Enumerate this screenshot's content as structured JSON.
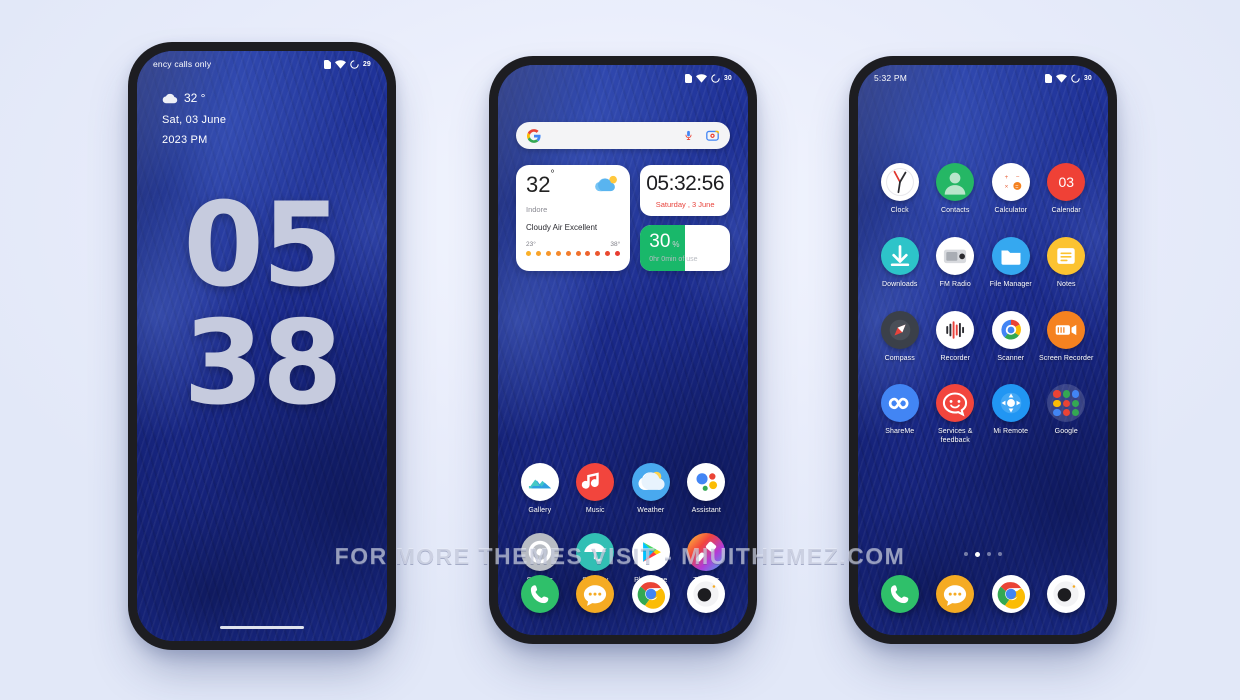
{
  "watermark": "FOR MORE THEMES VISIT - MIUITHEMEZ.COM",
  "colors": {
    "wallpaper_blue": "#1b2b8e",
    "page_background": "#eaeefb",
    "phone_frame": "#1d1d21",
    "accent_red": "#e8433c",
    "battery_green": "#19b86a"
  },
  "phone1": {
    "status": {
      "carrier": "ency calls only",
      "battery": "29"
    },
    "lock": {
      "temperature": "32 °",
      "weather_icon": "cloud-icon",
      "date": "Sat, 03 June",
      "ampm": "2023 PM",
      "clock_hours": "05",
      "clock_minutes": "38"
    }
  },
  "phone2": {
    "status": {
      "time": "",
      "battery": "30"
    },
    "search": {
      "logo": "google-g-icon",
      "mic": "mic-icon",
      "lens": "lens-icon",
      "placeholder": ""
    },
    "weather_widget": {
      "temperature": "32",
      "degree": "°",
      "icon": "cloud-sun-icon",
      "city": "Indore",
      "condition": "Cloudy Air Excellent",
      "low": "23°",
      "high": "38°",
      "dot_count": 10
    },
    "clock_widget": {
      "time": "05:32:56",
      "date": "Saturday , 3 June"
    },
    "battery_widget": {
      "percent": "30",
      "unit": "%",
      "usage": "0hr 0min of use",
      "fill_pct": 50
    },
    "apps": [
      {
        "label": "Gallery",
        "icon": "gallery-icon"
      },
      {
        "label": "Music",
        "icon": "music-icon"
      },
      {
        "label": "Weather",
        "icon": "weather-icon"
      },
      {
        "label": "Assistant",
        "icon": "assistant-icon"
      },
      {
        "label": "Settings",
        "icon": "settings-icon"
      },
      {
        "label": "Security",
        "icon": "security-icon"
      },
      {
        "label": "Play Store",
        "icon": "play-store-icon"
      },
      {
        "label": "Themes",
        "icon": "themes-icon"
      }
    ],
    "dock": [
      {
        "label": "Phone",
        "icon": "phone-icon"
      },
      {
        "label": "Messages",
        "icon": "messages-icon"
      },
      {
        "label": "Chrome",
        "icon": "chrome-icon"
      },
      {
        "label": "Camera",
        "icon": "camera-icon"
      }
    ]
  },
  "phone3": {
    "status": {
      "time": "5:32 PM",
      "battery": "30"
    },
    "apps": [
      {
        "label": "Clock",
        "icon": "clock-icon"
      },
      {
        "label": "Contacts",
        "icon": "contacts-icon"
      },
      {
        "label": "Calculator",
        "icon": "calculator-icon"
      },
      {
        "label": "Calendar",
        "icon": "calendar-icon",
        "day": "03"
      },
      {
        "label": "Downloads",
        "icon": "download-icon"
      },
      {
        "label": "FM Radio",
        "icon": "fm-radio-icon"
      },
      {
        "label": "File Manager",
        "icon": "folder-icon"
      },
      {
        "label": "Notes",
        "icon": "notes-icon"
      },
      {
        "label": "Compass",
        "icon": "compass-icon"
      },
      {
        "label": "Recorder",
        "icon": "recorder-icon"
      },
      {
        "label": "Scanner",
        "icon": "scanner-icon"
      },
      {
        "label": "Screen Recorder",
        "icon": "screen-recorder-icon"
      },
      {
        "label": "ShareMe",
        "icon": "shareme-icon"
      },
      {
        "label": "Services & feedback",
        "icon": "services-feedback-icon"
      },
      {
        "label": "Mi Remote",
        "icon": "mi-remote-icon"
      },
      {
        "label": "Google",
        "icon": "google-folder-icon"
      }
    ],
    "page_dots": {
      "count": 4,
      "active_index": 1
    },
    "dock": [
      {
        "label": "Phone",
        "icon": "phone-icon"
      },
      {
        "label": "Messages",
        "icon": "messages-icon"
      },
      {
        "label": "Chrome",
        "icon": "chrome-icon"
      },
      {
        "label": "Camera",
        "icon": "camera-icon"
      }
    ]
  }
}
